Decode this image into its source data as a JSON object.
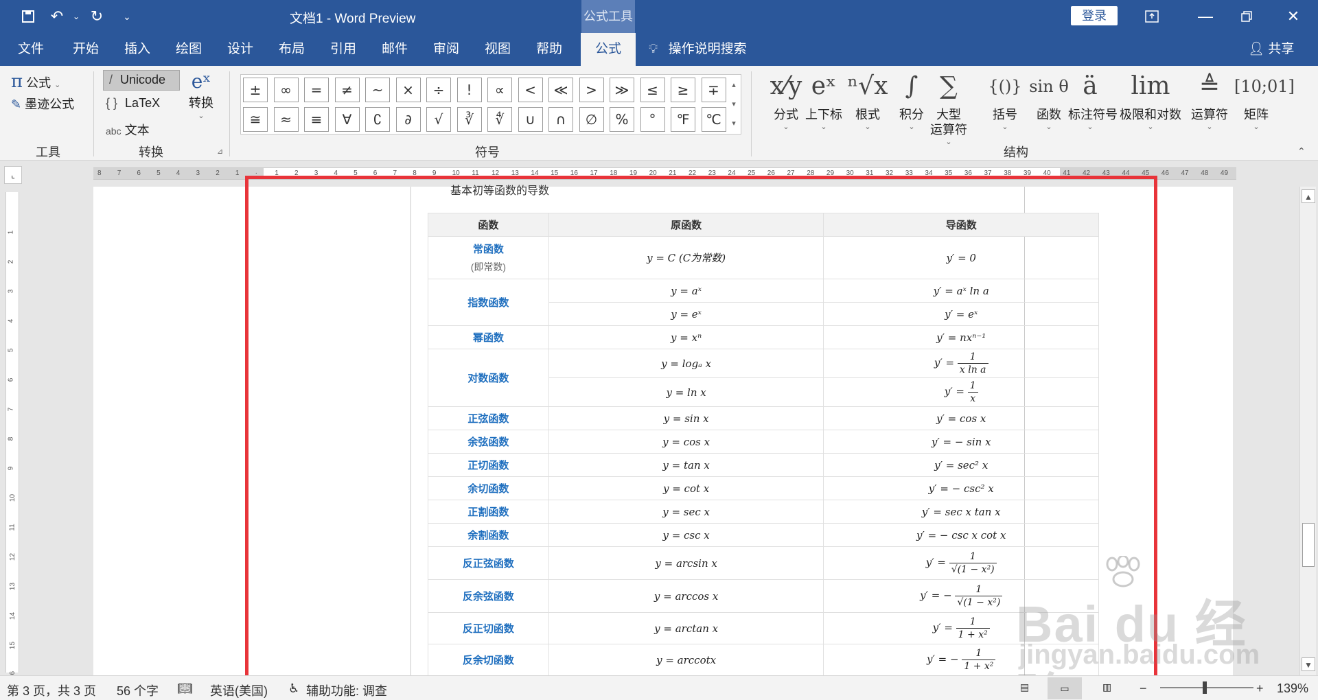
{
  "titlebar": {
    "document_title": "文档1  -  Word Preview",
    "context_tab": "公式工具",
    "login": "登录"
  },
  "tabs": [
    "文件",
    "开始",
    "插入",
    "绘图",
    "设计",
    "布局",
    "引用",
    "邮件",
    "审阅",
    "视图",
    "帮助",
    "公式"
  ],
  "search": "操作说明搜索",
  "share": "共享",
  "ribbon": {
    "tools_group": {
      "label": "工具",
      "equation": "公式",
      "ink": "墨迹公式"
    },
    "convert_group": {
      "label": "转换",
      "unicode": "Unicode",
      "latex": "LaTeX",
      "text": "文本",
      "convert": "转换"
    },
    "symbols_group": {
      "label": "符号",
      "row1": [
        "±",
        "∞",
        "=",
        "≠",
        "~",
        "×",
        "÷",
        "!",
        "∝",
        "<",
        "≪",
        ">",
        "≫",
        "≤",
        "≥",
        "∓"
      ],
      "row2": [
        "≅",
        "≈",
        "≡",
        "∀",
        "∁",
        "∂",
        "√",
        "∛",
        "∜",
        "∪",
        "∩",
        "∅",
        "%",
        "°",
        "℉",
        "℃"
      ]
    },
    "structures_group": {
      "label": "结构",
      "items": [
        {
          "glyph": "x⁄y",
          "label": "分式"
        },
        {
          "glyph": "eˣ",
          "label": "上下标"
        },
        {
          "glyph": "ⁿ√x",
          "label": "根式"
        },
        {
          "glyph": "∫",
          "label": "积分"
        },
        {
          "glyph": "∑",
          "label": "大型\n运算符"
        },
        {
          "glyph": "{()}",
          "label": "括号"
        },
        {
          "glyph": "sin θ",
          "label": "函数"
        },
        {
          "glyph": "ä",
          "label": "标注符号"
        },
        {
          "glyph": "lim",
          "label": "极限和对数"
        },
        {
          "glyph": "≜",
          "label": "运算符"
        },
        {
          "glyph": "[10;01]",
          "label": "矩阵"
        }
      ]
    }
  },
  "document": {
    "overflow_text": "基本初等函数的导数",
    "headers": [
      "函数",
      "原函数",
      "导函数"
    ],
    "rows": [
      {
        "fn": "常函数",
        "fn_sub": "(即常数)",
        "orig": "y = C   (C为常数)",
        "deriv": "y′ = 0"
      },
      {
        "fn": "指数函数",
        "orig": "y = aˣ",
        "deriv": "y′ = aˣ ln a",
        "orig2": "y = eˣ",
        "deriv2": "y′ = eˣ"
      },
      {
        "fn": "幂函数",
        "orig": "y = xⁿ",
        "deriv": "y′ = nxⁿ⁻¹"
      },
      {
        "fn": "对数函数",
        "orig": "y = logₐ x",
        "deriv_pre": "y′ =",
        "deriv_num": "1",
        "deriv_den": "x ln a",
        "orig2": "y = ln x",
        "deriv2_pre": "y′ =",
        "deriv2_num": "1",
        "deriv2_den": "x"
      },
      {
        "fn": "正弦函数",
        "orig": "y = sin x",
        "deriv": "y′ = cos x"
      },
      {
        "fn": "余弦函数",
        "orig": "y = cos x",
        "deriv": "y′ = − sin x"
      },
      {
        "fn": "正切函数",
        "orig": "y = tan x",
        "deriv": "y′ = sec² x"
      },
      {
        "fn": "余切函数",
        "orig": "y = cot x",
        "deriv": "y′ = − csc² x"
      },
      {
        "fn": "正割函数",
        "orig": "y = sec x",
        "deriv": "y′ = sec x tan x"
      },
      {
        "fn": "余割函数",
        "orig": "y = csc x",
        "deriv": "y′ = − csc x cot x"
      },
      {
        "fn": "反正弦函数",
        "orig": "y = arcsin x",
        "deriv_pre": "y′ =",
        "deriv_num": "1",
        "deriv_den": "√(1 − x²)"
      },
      {
        "fn": "反余弦函数",
        "orig": "y = arccos x",
        "deriv_pre": "y′ = −",
        "deriv_num": "1",
        "deriv_den": "√(1 − x²)"
      },
      {
        "fn": "反正切函数",
        "orig": "y = arctan x",
        "deriv_pre": "y′ =",
        "deriv_num": "1",
        "deriv_den": "1 + x²"
      },
      {
        "fn": "反余切函数",
        "orig": "y = arccotx",
        "deriv_pre": "y′ = −",
        "deriv_num": "1",
        "deriv_den": "1 + x²"
      }
    ]
  },
  "watermark": {
    "brand": "Bai du 经验",
    "site": "jingyan.baidu.com"
  },
  "status": {
    "page": "第 3 页，共 3 页",
    "words": "56 个字",
    "language": "英语(美国)",
    "accessibility": "辅助功能: 调查",
    "zoom": "139%"
  },
  "colors": {
    "brand": "#2b579a",
    "highlight": "#e8343a",
    "link": "#1f6fbf"
  }
}
